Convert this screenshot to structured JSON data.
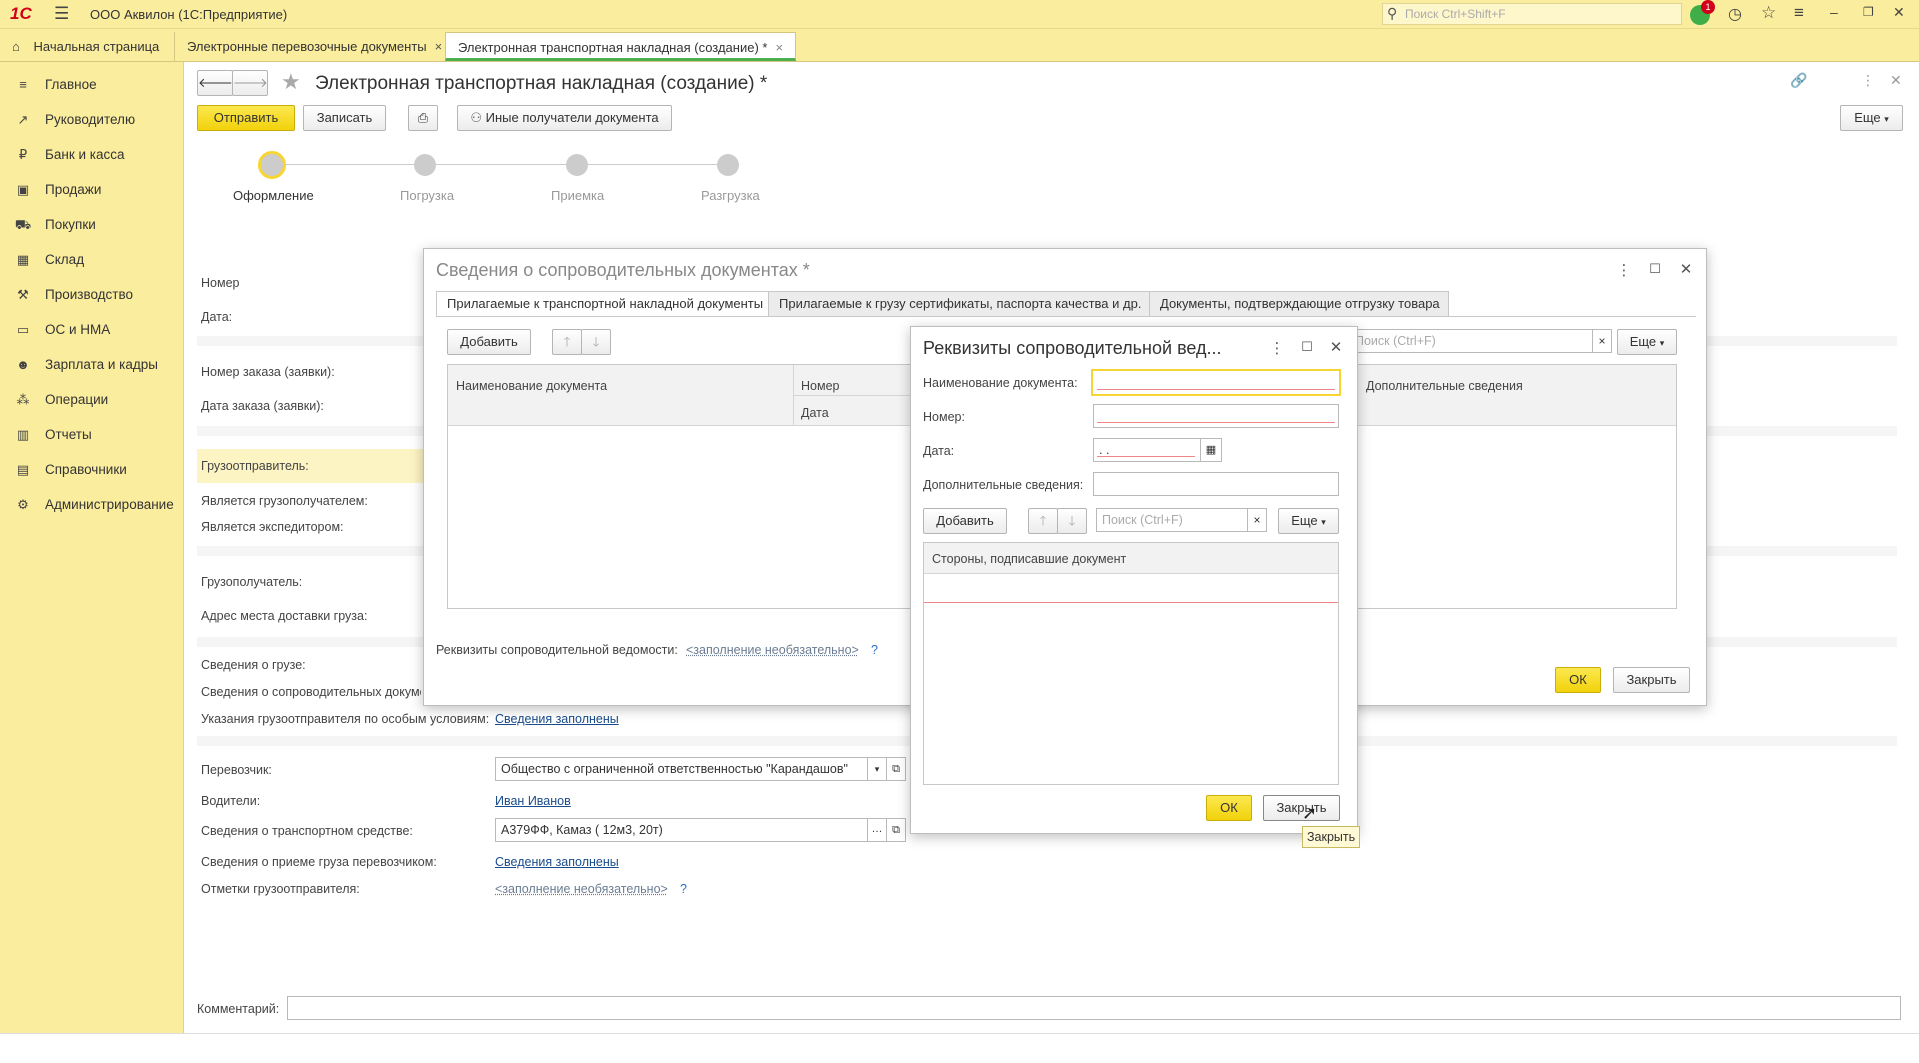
{
  "app": {
    "logo": "1С",
    "title": "ООО Аквилон  (1С:Предприятие)",
    "search_placeholder": "Поиск Ctrl+Shift+F",
    "notification_count": "1"
  },
  "tabs": {
    "home": "Начальная страница",
    "tab1": "Электронные перевозочные документы",
    "tab2": "Электронная транспортная накладная (создание) *",
    "close_glyph": "×"
  },
  "sidebar": {
    "items": [
      {
        "label": "Главное",
        "icon": "≡"
      },
      {
        "label": "Руководителю",
        "icon": "↗"
      },
      {
        "label": "Банк и касса",
        "icon": "₽"
      },
      {
        "label": "Продажи",
        "icon": "▣"
      },
      {
        "label": "Покупки",
        "icon": "⛟"
      },
      {
        "label": "Склад",
        "icon": "▦"
      },
      {
        "label": "Производство",
        "icon": "⚒"
      },
      {
        "label": "ОС и НМА",
        "icon": "▭"
      },
      {
        "label": "Зарплата и кадры",
        "icon": "☻"
      },
      {
        "label": "Операции",
        "icon": "⁂"
      },
      {
        "label": "Отчеты",
        "icon": "▥"
      },
      {
        "label": "Справочники",
        "icon": "▤"
      },
      {
        "label": "Администрирование",
        "icon": "⚙"
      }
    ]
  },
  "form": {
    "title": "Электронная транспортная накладная (создание) *",
    "send": "Отправить",
    "save": "Записать",
    "other_recipients": "Иные получатели документа",
    "more": "Еще",
    "steps": [
      "Оформление",
      "Погрузка",
      "Приемка",
      "Разгрузка"
    ],
    "labels": {
      "number": "Номер",
      "date": "Дата:",
      "order_number": "Номер заказа (заявки):",
      "order_date": "Дата заказа (заявки):",
      "shipper": "Грузоотправитель:",
      "is_consignee": "Является грузополучателем:",
      "is_forwarder": "Является экспедитором:",
      "consignee": "Грузополучатель:",
      "delivery_address": "Адрес места доставки груза:",
      "cargo_info": "Сведения о грузе:",
      "accompanying": "Сведения о сопроводительных документах:",
      "special_conditions": "Указания грузоотправителя по особым условиям:",
      "carrier": "Перевозчик:",
      "drivers": "Водители:",
      "vehicle": "Сведения о транспортном средстве:",
      "acceptance": "Сведения о приеме груза перевозчиком:",
      "shipper_marks": "Отметки грузоотправителя:",
      "comment": "Комментарий:"
    },
    "values": {
      "special_conditions": "Сведения заполнены",
      "carrier": "Общество с ограниченной ответственностью \"Карандашов\"",
      "drivers": "Иван Иванов",
      "vehicle": "А379ФФ, Камаз ( 12м3, 20т)",
      "acceptance": "Сведения заполнены",
      "shipper_marks": "<заполнение необязательно>",
      "qmark": "?"
    }
  },
  "dialog1": {
    "title": "Сведения о сопроводительных документах *",
    "tabs": [
      "Прилагаемые к транспортной накладной документы",
      "Прилагаемые к грузу сертификаты, паспорта качества и др.",
      "Документы, подтверждающие отгрузку товара"
    ],
    "add": "Добавить",
    "search_placeholder": "Поиск (Ctrl+F)",
    "more": "Еще",
    "columns": {
      "name": "Наименование документа",
      "number": "Номер",
      "date": "Дата",
      "extra": "Дополнительные сведения"
    },
    "statement_label": "Реквизиты сопроводительной ведомости:",
    "statement_value": "<заполнение необязательно>",
    "qmark": "?",
    "ok": "ОК",
    "close": "Закрыть"
  },
  "dialog2": {
    "title": "Реквизиты сопроводительной вед...",
    "labels": {
      "doc_name": "Наименование документа:",
      "number": "Номер:",
      "date": "Дата:",
      "extra": "Дополнительные сведения:"
    },
    "date_value": " .  .",
    "add": "Добавить",
    "search_placeholder": "Поиск (Ctrl+F)",
    "more": "Еще",
    "column": "Стороны, подписавшие документ",
    "ok": "ОК",
    "close": "Закрыть",
    "tooltip": "Закрыть"
  },
  "colors": {
    "accent_yellow": "#fbed9e",
    "button_yellow": "#f2d20b",
    "link": "#1a4c8c"
  }
}
